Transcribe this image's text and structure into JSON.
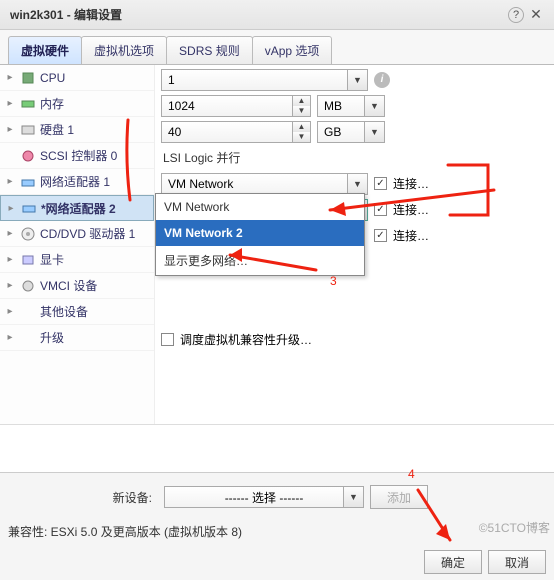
{
  "title": "win2k301 - 编辑设置",
  "tabs": [
    "虚拟硬件",
    "虚拟机选项",
    "SDRS 规则",
    "vApp 选项"
  ],
  "active_tab": 0,
  "hw": {
    "cpu": {
      "label": "CPU",
      "value": "1"
    },
    "mem": {
      "label": "内存",
      "value": "1024",
      "unit": "MB"
    },
    "disk": {
      "label": "硬盘 1",
      "value": "40",
      "unit": "GB"
    },
    "scsi": {
      "label": "SCSI 控制器 0",
      "value": "LSI Logic 并行"
    },
    "nic1": {
      "label": "网络适配器 1",
      "value": "VM Network",
      "connect": "连接…"
    },
    "nic2": {
      "label": "*网络适配器 2",
      "value": "VM Network 2",
      "connect": "连接…"
    },
    "cddvd": {
      "label": "CD/DVD 驱动器 1",
      "connect": "连接…"
    },
    "gpu": {
      "label": "显卡"
    },
    "vmci": {
      "label": "VMCI 设备"
    },
    "other": {
      "label": "其他设备"
    },
    "upgrade": {
      "label": "升级",
      "text": "调度虚拟机兼容性升级…"
    }
  },
  "dropdown": {
    "items": [
      "VM Network",
      "VM Network 2",
      "显示更多网络…"
    ],
    "selected": 1
  },
  "newdev": {
    "label": "新设备:",
    "value": "------ 选择 ------",
    "add": "添加"
  },
  "compat": "兼容性: ESXi 5.0 及更高版本 (虚拟机版本 8)",
  "footer": {
    "ok": "确定",
    "cancel": "取消"
  },
  "watermark": "©51CTO博客"
}
